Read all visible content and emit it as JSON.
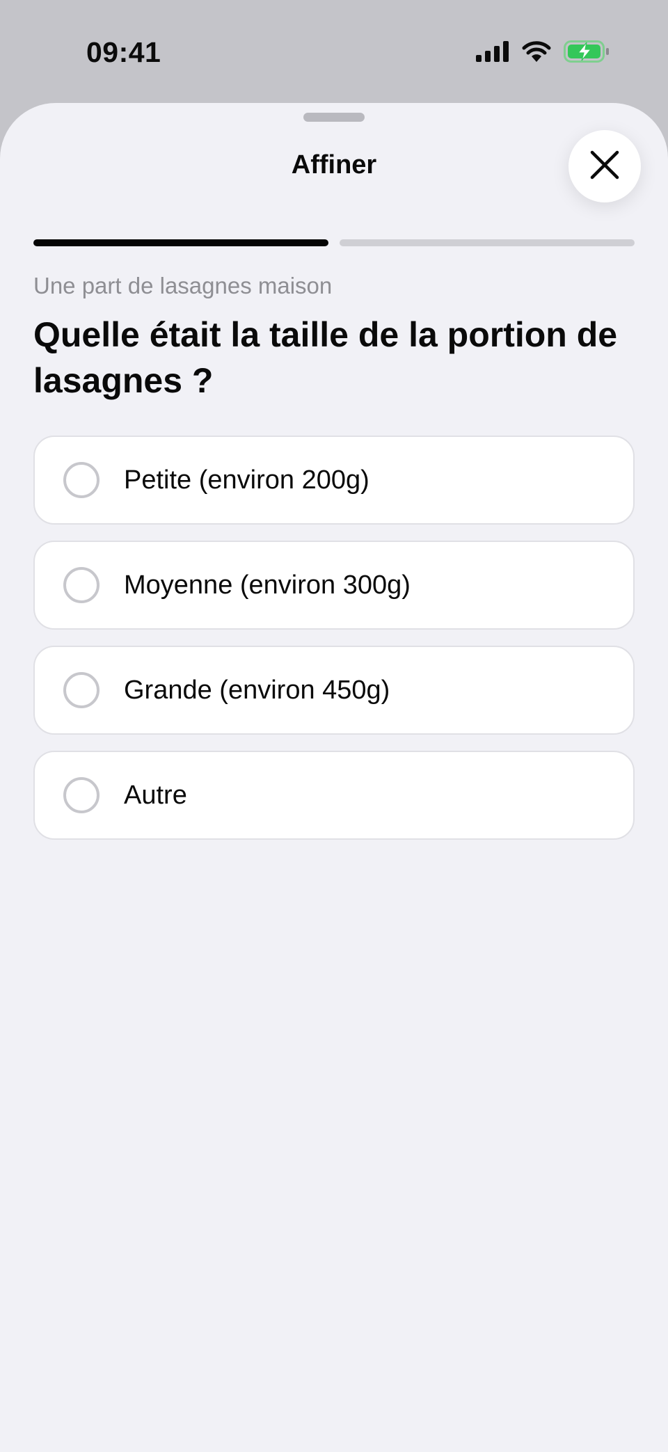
{
  "status_bar": {
    "time": "09:41",
    "icons": [
      "cellular-signal-icon",
      "wifi-icon",
      "battery-charging-icon"
    ],
    "battery_color": "#34c759"
  },
  "sheet": {
    "title": "Affiner",
    "close_icon": "close-icon",
    "progress": {
      "total_steps": 2,
      "completed_steps": 1
    },
    "subtitle": "Une part de lasagnes maison",
    "question": "Quelle était la taille de la portion de lasagnes ?",
    "options": [
      {
        "label": "Petite (environ 200g)",
        "selected": false
      },
      {
        "label": "Moyenne (environ 300g)",
        "selected": false
      },
      {
        "label": "Grande (environ 450g)",
        "selected": false
      },
      {
        "label": "Autre",
        "selected": false
      }
    ]
  },
  "colors": {
    "sheet_background": "#f1f1f6",
    "backdrop": "#c4c4c9",
    "progress_active": "#050505",
    "progress_inactive": "#cfcfd4",
    "subtitle_text": "#8e8e93"
  }
}
